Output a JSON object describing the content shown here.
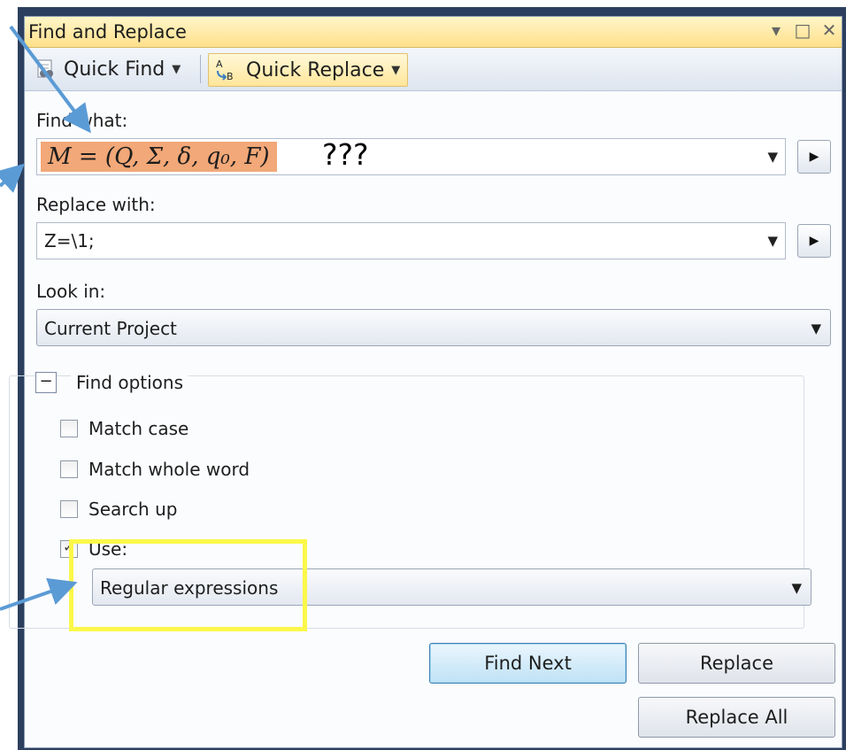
{
  "window": {
    "title": "Find and Replace",
    "buttons": {
      "pin": "▾",
      "maximize": "□",
      "close": "✕"
    }
  },
  "toolbar": {
    "quick_find": "Quick Find",
    "quick_replace": "Quick Replace"
  },
  "find": {
    "label": "Find what:",
    "math_value": "M = (Q, Σ, δ, q₀, F)",
    "suffix": "???"
  },
  "replace": {
    "label": "Replace with:",
    "value": "Z=\\1;"
  },
  "look_in": {
    "label": "Look in:",
    "selected": "Current Project"
  },
  "options": {
    "group_label": "Find options",
    "match_case": "Match case",
    "match_whole_word": "Match whole word",
    "search_up": "Search up",
    "use": "Use:",
    "use_selected": "Regular expressions"
  },
  "actions": {
    "find_next": "Find Next",
    "replace": "Replace",
    "replace_all": "Replace All"
  },
  "colors": {
    "highlight": "#f2a878",
    "annotation_box": "#fbf84a",
    "arrow": "#5b9bd5",
    "title_bar": "#ffe08a"
  }
}
